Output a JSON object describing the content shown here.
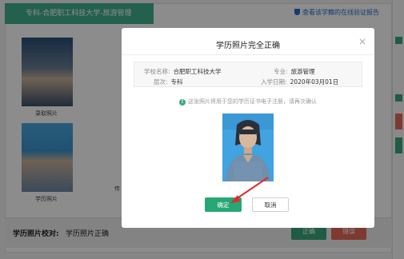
{
  "background": {
    "banner_text": "专科-合肥职工科技大学-旅游管理",
    "verify_link": "查看该学籍的在线验证报告",
    "photo1_caption": "录取照片",
    "photo2_caption": "学历照片",
    "side_text": "传",
    "bottom_label": "学历照片校对:",
    "bottom_value": "学历照片正确",
    "confirm_btn": "正确",
    "error_btn": "错误"
  },
  "modal": {
    "title": "学历照片完全正确",
    "close_icon": "×",
    "school_label": "学校名称:",
    "school_value": "合肥职工科技大学",
    "major_label": "专业:",
    "major_value": "旅游管理",
    "level_label": "层次:",
    "level_value": "专科",
    "enroll_label": "入学日期:",
    "enroll_value": "2020年03月01日",
    "notice_icon": "!",
    "notice_text": "这张照片将用于您的学历证书电子注册，请再次确认",
    "confirm_label": "确定",
    "cancel_label": "取消"
  },
  "colors": {
    "accent_green": "#27a774",
    "banner_green": "#41b08e",
    "link_blue": "#2d6cc9",
    "arrow_red": "#e02b2b"
  }
}
